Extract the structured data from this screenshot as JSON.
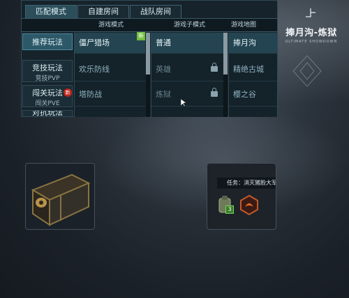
{
  "mode_tabs": [
    {
      "label": "匹配模式",
      "active": true
    },
    {
      "label": "自建房间",
      "active": false
    },
    {
      "label": "战队房间",
      "active": false
    }
  ],
  "columns": {
    "game_mode": "游戏模式",
    "sub_mode": "游戏子模式",
    "map": "游戏地图"
  },
  "nav": [
    {
      "label": "推荐玩法",
      "sub": "",
      "active": true
    },
    {
      "label": "竞技玩法",
      "sub": "竞技PVP",
      "active": false
    },
    {
      "label": "闯关玩法",
      "sub": "闯关PVE",
      "active": false,
      "badge": "新"
    },
    {
      "label": "对抗玩法",
      "sub": "",
      "active": false
    }
  ],
  "game_modes": {
    "header": "僵尸猎场",
    "items": [
      "欢乐防线",
      "塔防战"
    ],
    "new_tag": "新"
  },
  "sub_modes": {
    "header": "普通",
    "items": [
      "英雄",
      "炼狱"
    ]
  },
  "maps": {
    "header": "捧月沟",
    "items": [
      "精绝古城",
      "樱之谷"
    ]
  },
  "logo": {
    "title": "捧月沟-炼狱",
    "tagline": "ULTIMATE SHOWDOWN"
  },
  "task": {
    "text": "任务：消灭猪脸大军",
    "count": "3"
  },
  "colors": {
    "accent": "#2c5868",
    "panel": "#16232b",
    "badge_red": "#c0241b",
    "new_green": "#6fbf3a"
  }
}
